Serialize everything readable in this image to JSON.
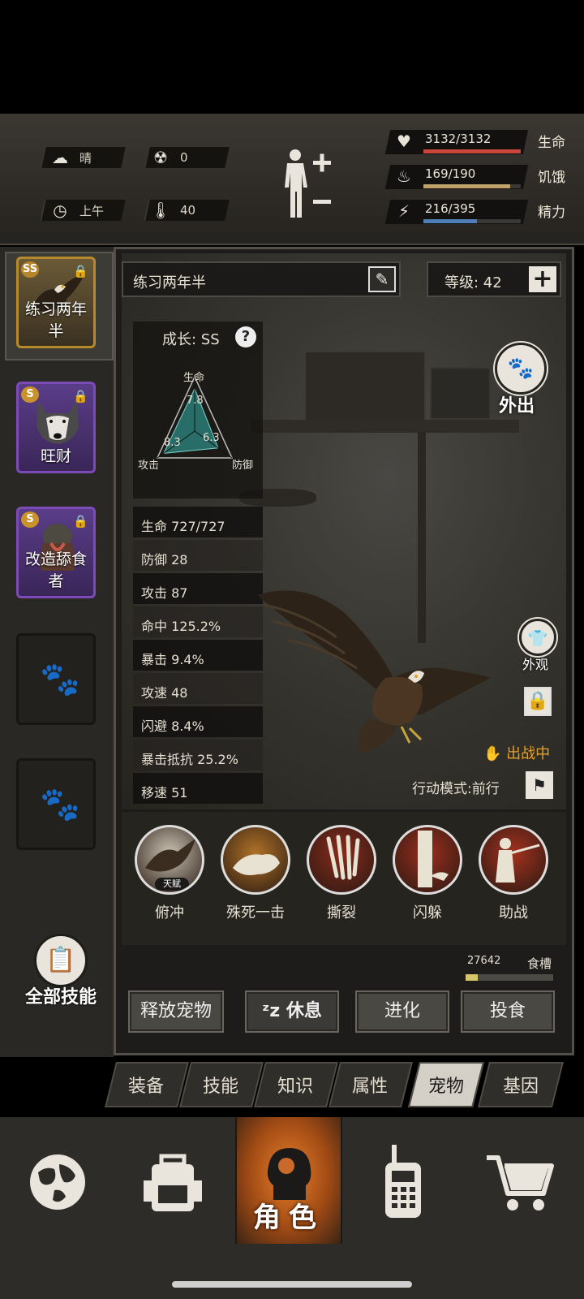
{
  "status": {
    "weather": "晴",
    "radiation": "0",
    "time_of_day": "上午",
    "temperature": "40"
  },
  "vitals": {
    "life": {
      "label": "生命",
      "value": "3132/3132",
      "fraction": 1.0,
      "color": "#c8463a"
    },
    "hunger": {
      "label": "饥饿",
      "value": "169/190",
      "fraction": 0.889,
      "color": "#bfa36a"
    },
    "energy": {
      "label": "精力",
      "value": "216/395",
      "fraction": 0.547,
      "color": "#4f7fb6"
    }
  },
  "pets": [
    {
      "name": "练习两年半",
      "grade": "SS",
      "locked": true
    },
    {
      "name": "旺财",
      "grade": "S",
      "locked": true
    },
    {
      "name": "改造舔食者",
      "grade": "S",
      "locked": true
    }
  ],
  "pet_detail": {
    "name": "练习两年半",
    "level_text": "等级: 42",
    "growth_label": "成长: SS",
    "radar": {
      "life_label": "生命",
      "attack_label": "攻击",
      "defense_label": "防御",
      "life_val": "7.8",
      "attack_val": "8.3",
      "defense_val": "6.3",
      "life": 7.8,
      "attack": 8.3,
      "defense": 6.3
    },
    "stats": [
      "生命 727/727",
      "防御 28",
      "攻击 87",
      "命中 125.2%",
      "暴击 9.4%",
      "攻速 48",
      "闪避 8.4%",
      "暴击抵抗 25.2%",
      "移速 51"
    ],
    "outing_label": "外出",
    "appearance_label": "外观",
    "deploy_status": "出战中",
    "action_mode": "行动模式:前行"
  },
  "skills": [
    {
      "name": "俯冲",
      "tag": "天赋",
      "color": "#c9c2b3"
    },
    {
      "name": "殊死一击",
      "color": "#b07228"
    },
    {
      "name": "撕裂",
      "color": "#8a2a1c"
    },
    {
      "name": "闪躲",
      "color": "#9a2d1e"
    },
    {
      "name": "助战",
      "color": "#a3311f"
    }
  ],
  "all_skills_label": "全部技能",
  "food": {
    "count": "27642",
    "label": "食槽",
    "fraction": 0.14
  },
  "actions": {
    "release": "释放宠物",
    "rest": "休息",
    "evolve": "进化",
    "feed": "投食"
  },
  "tabs": [
    {
      "label": "装备",
      "active": false
    },
    {
      "label": "技能",
      "active": false
    },
    {
      "label": "知识",
      "active": false
    },
    {
      "label": "属性",
      "active": false
    },
    {
      "label": "宠物",
      "active": true
    },
    {
      "label": "基因",
      "active": false
    }
  ],
  "bottom_nav": {
    "active_label": "角色",
    "items": [
      "globe-icon",
      "backpack-icon",
      "character-icon",
      "walkie-talkie-icon",
      "cart-icon"
    ]
  }
}
